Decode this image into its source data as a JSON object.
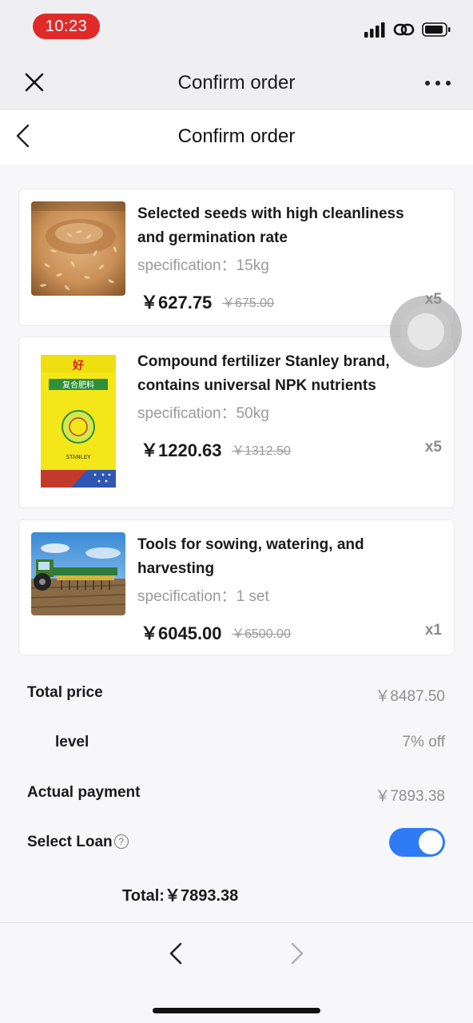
{
  "status_bar": {
    "time": "10:23"
  },
  "mini_program_bar": {
    "title": "Confirm order",
    "close_icon": "close-icon",
    "more_icon": "more-dots-icon"
  },
  "header": {
    "title": "Confirm order",
    "back_icon": "chevron-left-icon"
  },
  "products": [
    {
      "name": "Selected seeds with high cleanliness and germination rate",
      "spec_label": "specification：",
      "spec_value": "15kg",
      "price": "￥627.75",
      "old_price": "￥675.00",
      "qty": "x5",
      "image": "rice-seeds-image"
    },
    {
      "name": "Compound fertilizer Stanley brand, contains universal NPK nutrients",
      "spec_label": "specification：",
      "spec_value": "50kg",
      "price": "￥1220.63",
      "old_price": "￥1312.50",
      "qty": "x5",
      "image": "fertilizer-bag-image",
      "bag_text": "复合肥料",
      "bag_brand": "STANLEY"
    },
    {
      "name": "Tools for sowing, watering, and harvesting",
      "spec_label": "specification：",
      "spec_value": "1 set",
      "price": "￥6045.00",
      "old_price": "￥6500.00",
      "qty": "x1",
      "image": "tractor-seeder-image"
    }
  ],
  "summary": {
    "total_price_label": "Total price",
    "total_price_value": "￥8487.50",
    "level_label": "level",
    "level_value": "7% off",
    "actual_payment_label": "Actual payment",
    "actual_payment_value": "￥7893.38",
    "select_loan_label": "Select Loan",
    "select_loan_on": true,
    "total_line": "Total:￥7893.38"
  },
  "colors": {
    "accent": "#2f7bf6",
    "time_pill": "#e02a2a"
  }
}
